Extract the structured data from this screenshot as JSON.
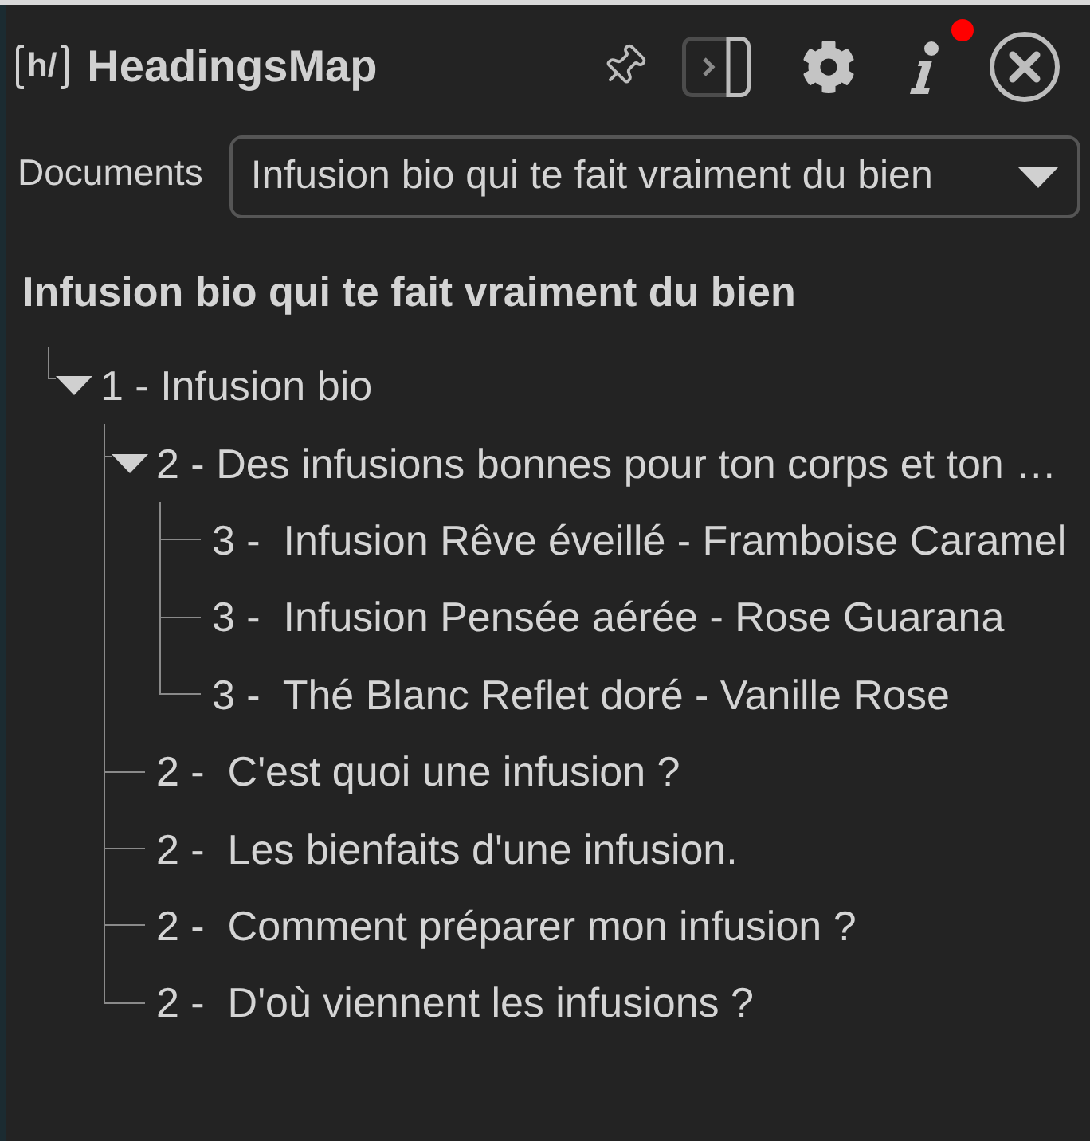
{
  "header": {
    "logo": "h/",
    "title": "HeadingsMap",
    "info_badge": true
  },
  "documents": {
    "label": "Documents",
    "value": "Infusion bio qui te fait vraiment du bien"
  },
  "document_title": "Infusion bio qui te fait vraiment du bien",
  "outline": [
    {
      "label": "1 - Infusion bio",
      "expanded": true,
      "children": [
        {
          "label": "2 - Des infusions bonnes pour ton corps et ton …",
          "expanded": true,
          "children": [
            {
              "label": "3 -  Infusion Rêve éveillé - Framboise Caramel"
            },
            {
              "label": "3 -  Infusion Pensée aérée - Rose Guarana"
            },
            {
              "label": "3 -  Thé Blanc Reflet doré - Vanille Rose"
            }
          ]
        },
        {
          "label": "2 -  C'est quoi une infusion ?"
        },
        {
          "label": "2 -  Les bienfaits d'une infusion."
        },
        {
          "label": "2 -  Comment préparer mon infusion ?"
        },
        {
          "label": "2 -  D'où viennent les infusions ?"
        }
      ]
    }
  ]
}
